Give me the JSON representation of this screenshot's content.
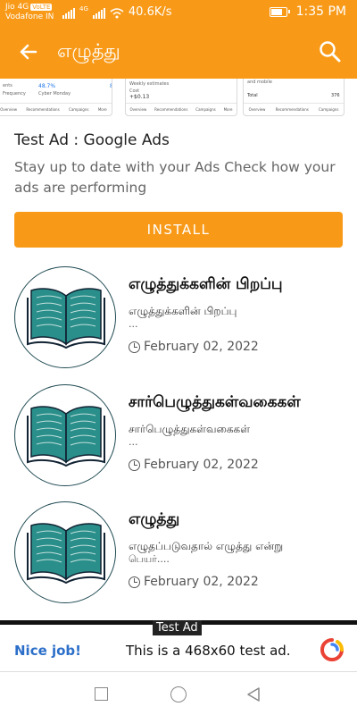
{
  "status_bar": {
    "carrier1": "Jio 4G",
    "volte": "VoLTE",
    "carrier2": "Vodafone IN",
    "network_type": "4G",
    "speed": "40.6K/s",
    "time": "1:35 PM",
    "battery_level": 0.8
  },
  "app_bar": {
    "title": "எழுத்து",
    "back_icon": "arrow-left-icon",
    "search_icon": "search-icon"
  },
  "ad_screenshots": {
    "shot1": {
      "line1": "ents",
      "stat1": "48.7%",
      "stat2": "8",
      "label1": "Frequency",
      "label2": "Cyber Monday",
      "nav": [
        "Overview",
        "Recommendations",
        "Campaigns",
        "More"
      ]
    },
    "shot2": {
      "line1": "Weekly estimates",
      "line2": "Cost",
      "value": "+$0.13",
      "nav": [
        "Overview",
        "Recommendations",
        "Campaigns",
        "More"
      ]
    },
    "shot3": {
      "line1": "and mobile",
      "total_label": "Total",
      "total_value": "376",
      "nav": [
        "Overview",
        "Recommendations",
        "Campaigns"
      ]
    }
  },
  "ad": {
    "title": "Test Ad : Google Ads",
    "description": "Stay up to date with your Ads Check how your ads are performing",
    "install_label": "INSTALL"
  },
  "articles": [
    {
      "title": "எழுத்துக்களின் பிறப்பு",
      "subtitle": "எழுத்துக்களின் பிறப்பு",
      "excerpt": "...",
      "date": "February 02, 2022",
      "thumbnail_icon": "open-book-icon"
    },
    {
      "title": "சார்பெழுத்துகள்வகைகள்",
      "subtitle": "சார்பெழுத்துகள்வகைகள்",
      "excerpt": "...",
      "date": "February 02, 2022",
      "thumbnail_icon": "open-book-icon"
    },
    {
      "title": "எழுத்து",
      "subtitle": "எழுதப்படுவதால் எழுத்து என்று",
      "excerpt": "பெயர்....",
      "date": "February 02, 2022",
      "thumbnail_icon": "open-book-icon"
    }
  ],
  "banner_ad": {
    "tag": "Test Ad",
    "nice_job": "Nice job!",
    "text": "This is a 468x60 test ad."
  },
  "colors": {
    "primary": "#f89a18",
    "book": "#2a8f8a",
    "link": "#2c6fc9"
  }
}
